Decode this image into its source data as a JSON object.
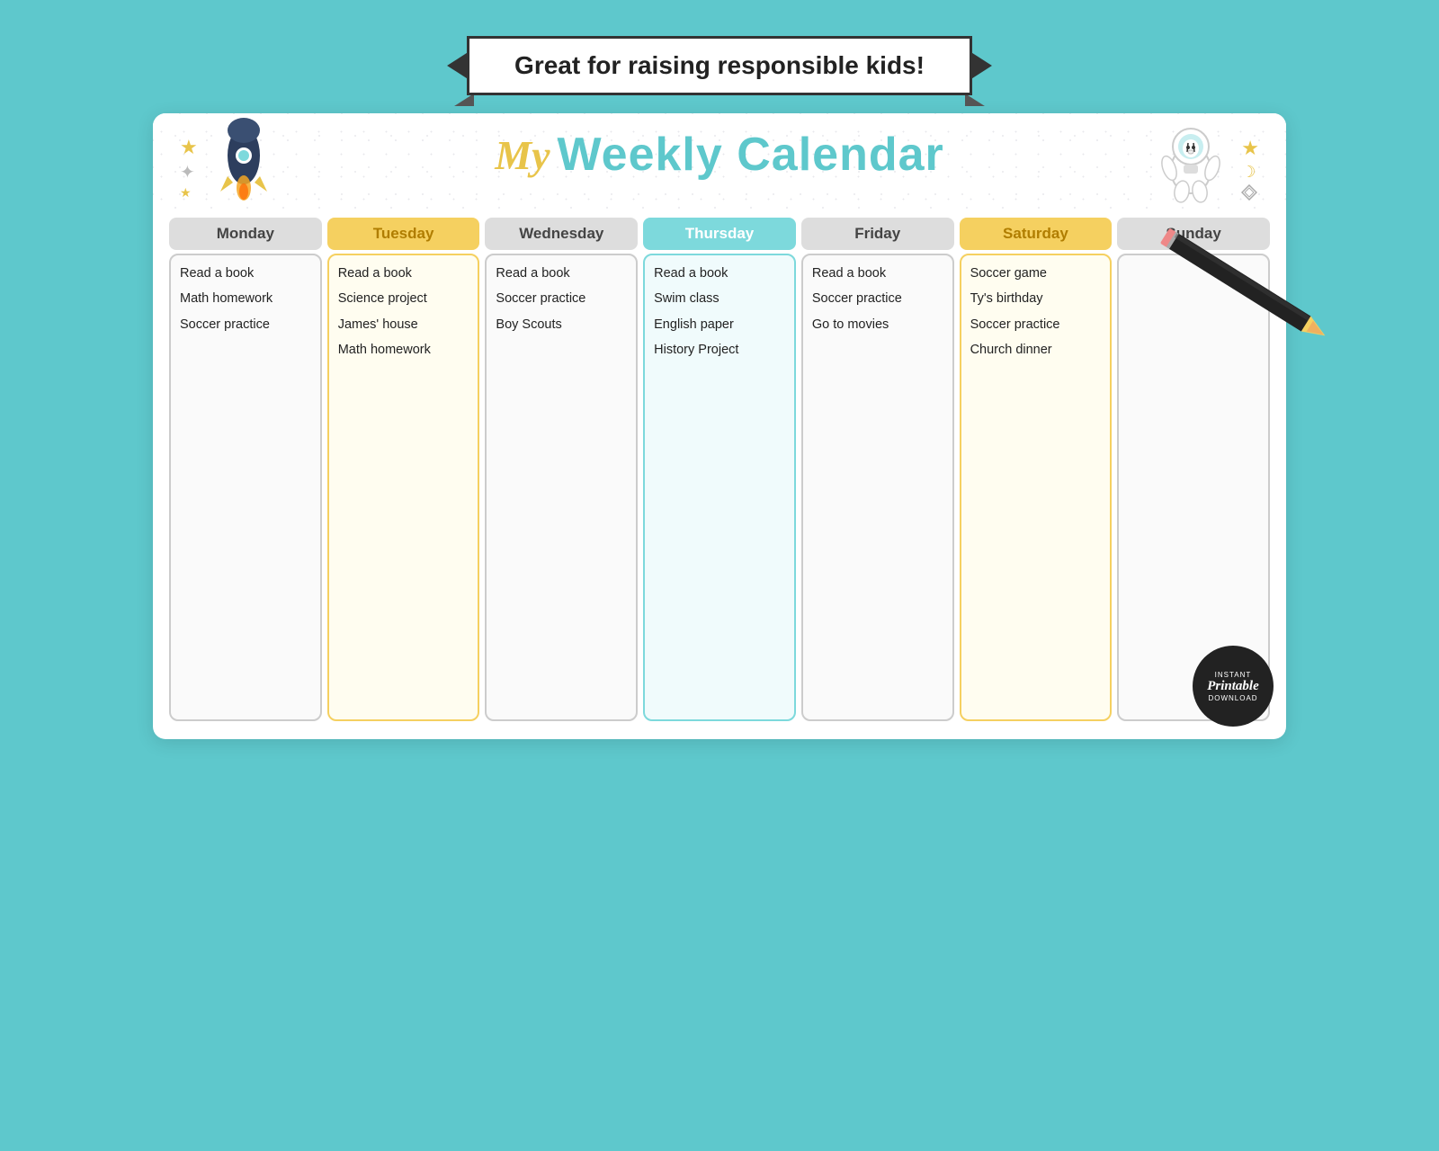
{
  "banner": {
    "text": "Great for raising responsible kids!"
  },
  "calendar": {
    "title_my": "My",
    "title_rest": "Weekly Calendar",
    "days": [
      {
        "name": "Monday",
        "headerStyle": "gray",
        "boxStyle": "gray-border",
        "items": [
          "Read a book",
          "Math homework",
          "Soccer practice"
        ]
      },
      {
        "name": "Tuesday",
        "headerStyle": "yellow",
        "boxStyle": "yellow-border",
        "items": [
          "Read a book",
          "Science project",
          "James' house",
          "Math homework"
        ]
      },
      {
        "name": "Wednesday",
        "headerStyle": "gray",
        "boxStyle": "gray-border",
        "items": [
          "Read a book",
          "Soccer practice",
          "Boy Scouts"
        ]
      },
      {
        "name": "Thursday",
        "headerStyle": "teal",
        "boxStyle": "teal-border",
        "items": [
          "Read a book",
          "Swim class",
          "English paper",
          "History Project"
        ]
      },
      {
        "name": "Friday",
        "headerStyle": "gray",
        "boxStyle": "gray-border",
        "items": [
          "Read a book",
          "Soccer practice",
          "Go to movies"
        ]
      },
      {
        "name": "Saturday",
        "headerStyle": "yellow",
        "boxStyle": "yellow-border",
        "items": [
          "Soccer game",
          "Ty's birthday",
          "Soccer practice",
          "Church dinner"
        ]
      },
      {
        "name": "Sunday",
        "headerStyle": "gray",
        "boxStyle": "gray-border",
        "items": []
      }
    ]
  },
  "badge": {
    "line1": "INSTANT",
    "line2": "Printable",
    "line3": "DOWNLOAD"
  }
}
